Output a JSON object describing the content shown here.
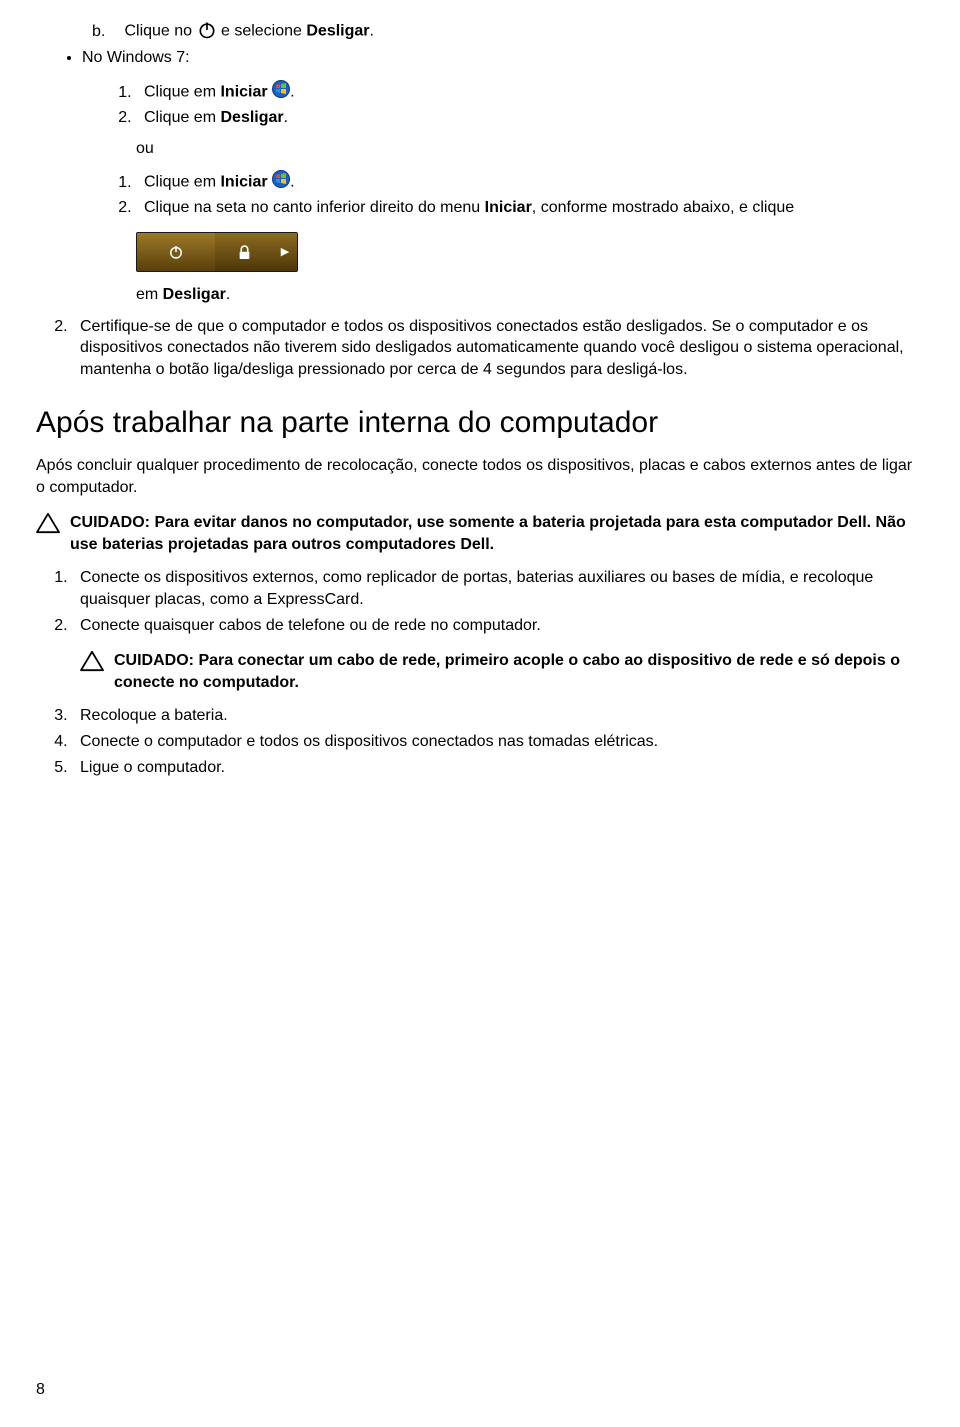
{
  "letter_b": {
    "marker": "b.",
    "pre": "Clique no",
    "post": " e selecione ",
    "bold": "Desligar",
    "end": "."
  },
  "bullet_win7": "No Windows 7:",
  "listA": {
    "i1_pre": "Clique em ",
    "i1_bold": "Iniciar",
    "i1_end": ".",
    "i2_pre": "Clique em ",
    "i2_bold": "Desligar",
    "i2_end": "."
  },
  "or_word": "ou",
  "listB": {
    "i1_pre": "Clique em ",
    "i1_bold": "Iniciar",
    "i1_end": ".",
    "i2_pre": "Clique na seta no canto inferior direito do menu ",
    "i2_bold": "Iniciar",
    "i2_post": ", conforme mostrado abaixo, e clique",
    "i2_line2_pre": "em ",
    "i2_line2_bold": "Desligar",
    "i2_line2_end": "."
  },
  "outer2": "Certifique-se de que o computador e todos os dispositivos conectados estão desligados. Se o computador e os dispositivos conectados não tiverem sido desligados automaticamente quando você desligou o sistema operacional, mantenha o botão liga/desliga pressionado por cerca de 4 segundos para desligá-los.",
  "heading": "Após trabalhar na parte interna do computador",
  "intro_para": "Após concluir qualquer procedimento de recolocação, conecte todos os dispositivos, placas e cabos externos antes de ligar o computador.",
  "caution1": "CUIDADO: Para evitar danos no computador, use somente a bateria projetada para esta computador Dell. Não use baterias projetadas para outros computadores Dell.",
  "steps": {
    "s1": "Conecte os dispositivos externos, como replicador de portas, baterias auxiliares ou bases de mídia, e recoloque quaisquer placas, como a ExpressCard.",
    "s2": "Conecte quaisquer cabos de telefone ou de rede no computador.",
    "s3": "Recoloque a bateria.",
    "s4": "Conecte o computador e todos os dispositivos conectados nas tomadas elétricas.",
    "s5": "Ligue o computador."
  },
  "caution2": "CUIDADO: Para conectar um cabo de rede, primeiro acople o cabo ao dispositivo de rede e só depois o conecte no computador.",
  "page_number": "8"
}
